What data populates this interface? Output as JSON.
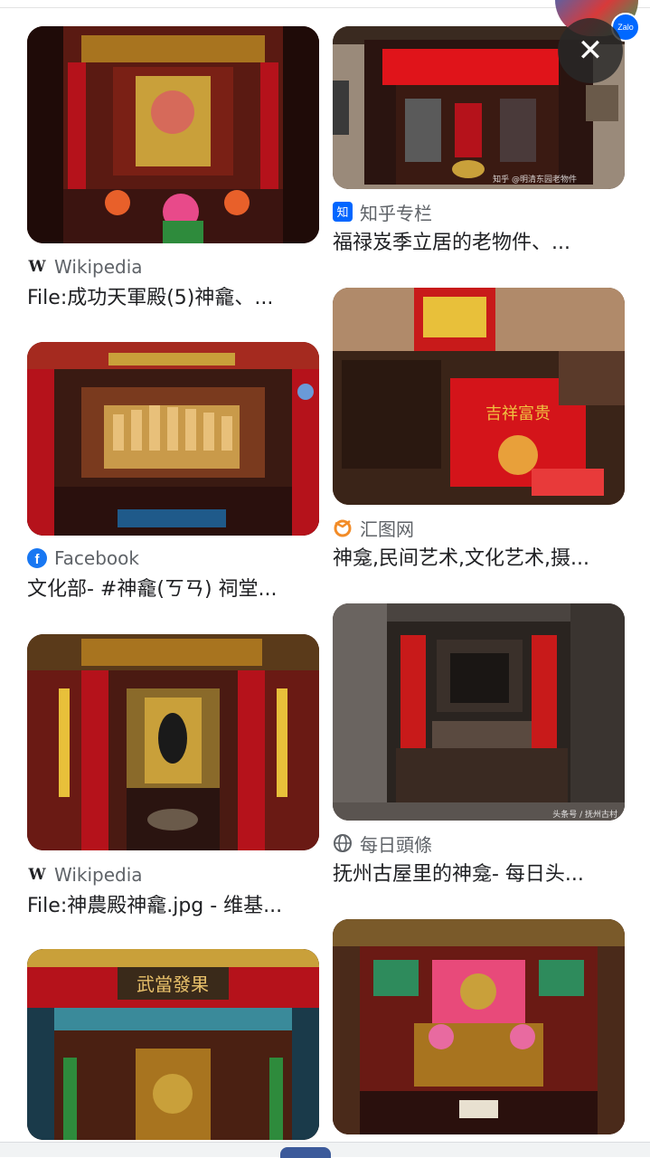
{
  "results": {
    "left": [
      {
        "source": "Wikipedia",
        "source_icon": "wikipedia-icon",
        "caption": "File:成功天軍殿(5)神龕、..."
      },
      {
        "source": "Facebook",
        "source_icon": "facebook-icon",
        "caption": "文化部- #神龕(ㄎㄢ) 祠堂..."
      },
      {
        "source": "Wikipedia",
        "source_icon": "wikipedia-icon",
        "caption": "File:神農殿神龕.jpg - 维基..."
      },
      {
        "source": "",
        "source_icon": "",
        "caption": ""
      }
    ],
    "right": [
      {
        "source": "知乎专栏",
        "source_icon": "zhihu-icon",
        "caption": "福禄岌季立居的老物件、..."
      },
      {
        "source": "汇图网",
        "source_icon": "huitu-icon",
        "caption": "神龛,民间艺术,文化艺术,摄..."
      },
      {
        "source": "每日頭條",
        "source_icon": "globe-icon",
        "caption": "抚州古屋里的神龛- 每日头..."
      },
      {
        "source": "",
        "source_icon": "",
        "caption": ""
      }
    ]
  },
  "image_texts": {
    "img_l4_sign": "武當發果",
    "img_r1_watermark": "知乎 @明清东园老物件",
    "img_r3_watermark": "头条号 / 抚州古村",
    "img_r2_cloth": "吉祥富贵"
  },
  "overlay": {
    "zalo_label": "Zalo",
    "close_glyph": "✕"
  },
  "colors": {
    "text": "#202124",
    "source": "#5f6368",
    "shrine_red": "#b5121b",
    "gold": "#c9a03a"
  }
}
